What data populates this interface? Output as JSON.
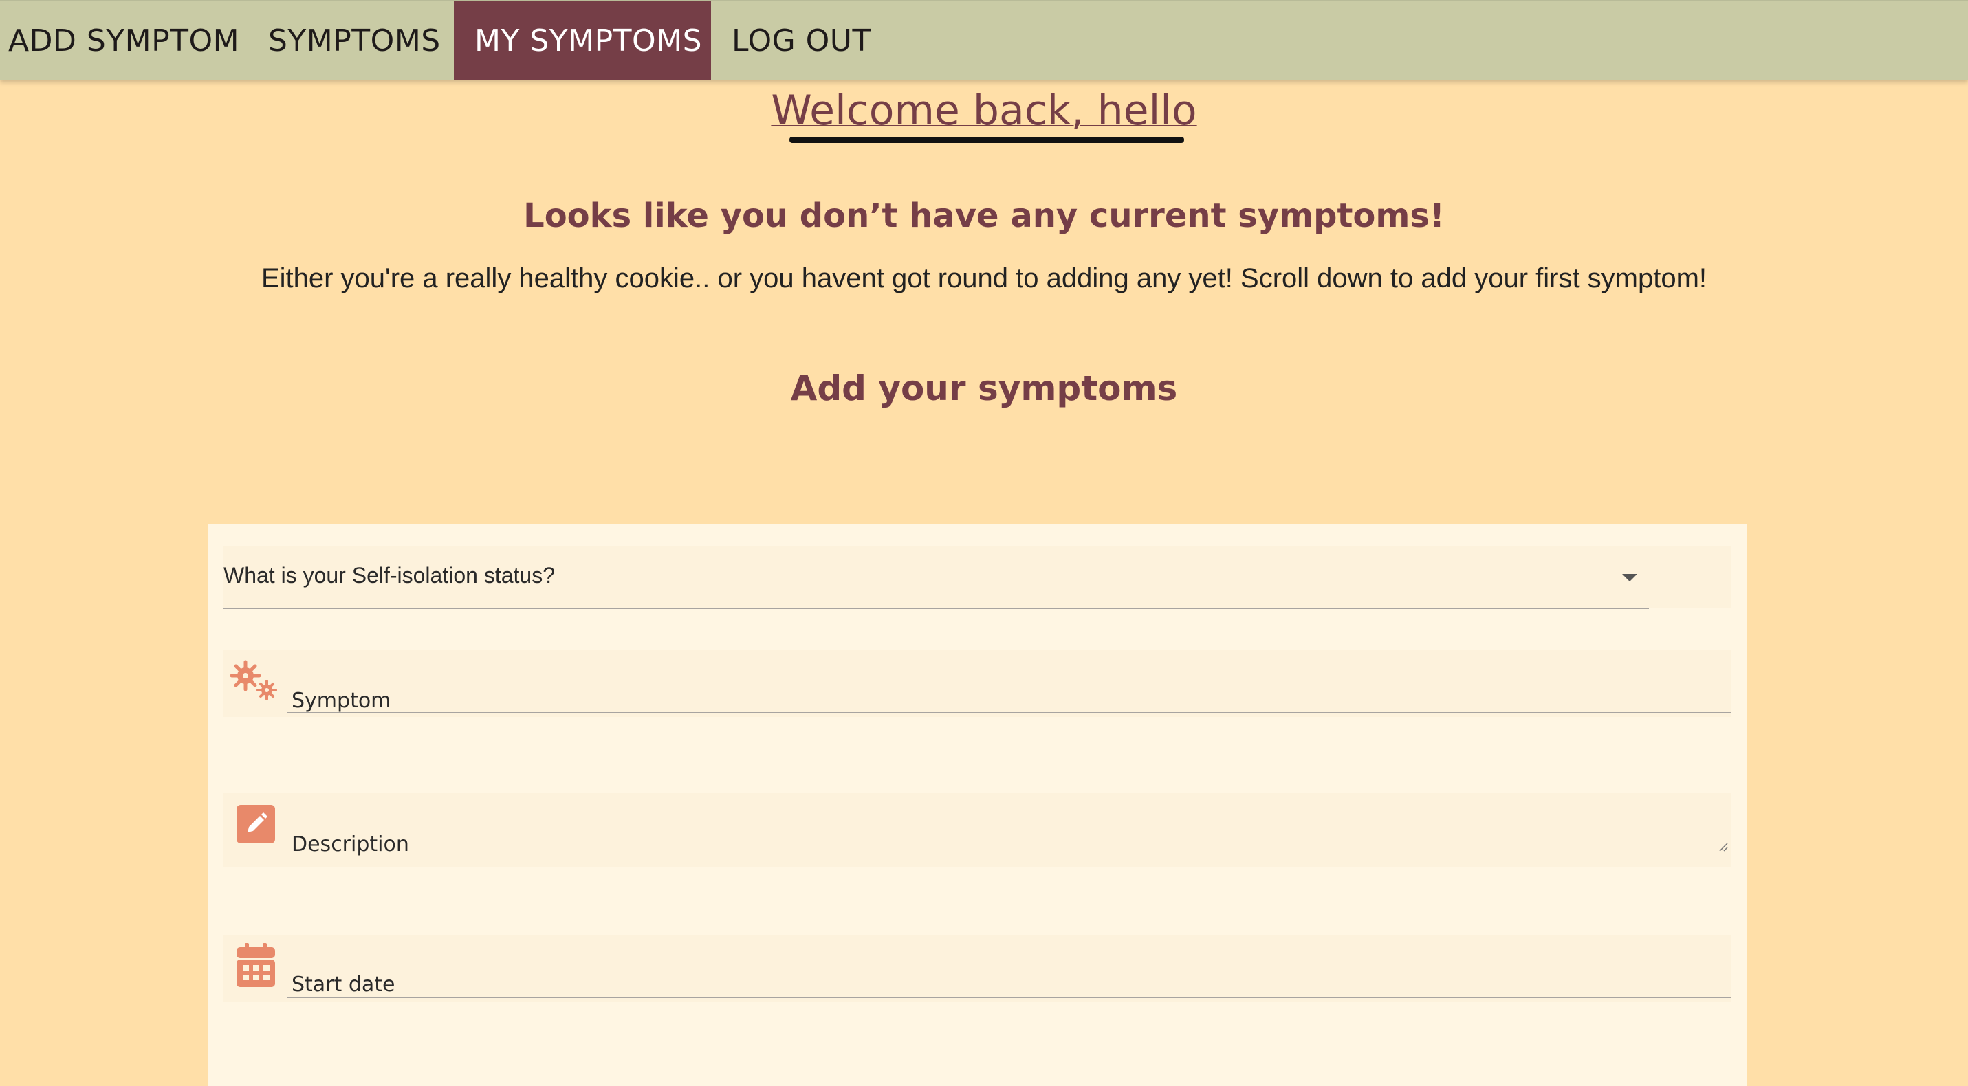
{
  "nav": {
    "items": [
      {
        "label": "ADD SYMPTOM"
      },
      {
        "label": "SYMPTOMS"
      },
      {
        "label": "MY SYMPTOMS"
      },
      {
        "label": "LOG OUT"
      }
    ],
    "active": "MY SYMPTOMS"
  },
  "main": {
    "welcome": "Welcome back, hello",
    "no_symptoms_title": "Looks like you don’t have any current symptoms!",
    "no_symptoms_text": "Either you're a really healthy cookie.. or you havent got round to adding any yet! Scroll down to add your first symptom!",
    "add_heading": "Add your symptoms"
  },
  "form": {
    "isolation_select": {
      "label": "What is your Self-isolation status?"
    },
    "symptom": {
      "label": "Symptom",
      "icon": "virus-icon"
    },
    "description": {
      "label": "Description",
      "icon": "pencil-icon"
    },
    "start_date": {
      "label": "Start date",
      "icon": "calendar-icon"
    }
  },
  "colors": {
    "background": "#ffdfa8",
    "navbar": "#c9cba5",
    "accent": "#753e47",
    "icon": "#e8896a",
    "card": "#fff6e3"
  }
}
